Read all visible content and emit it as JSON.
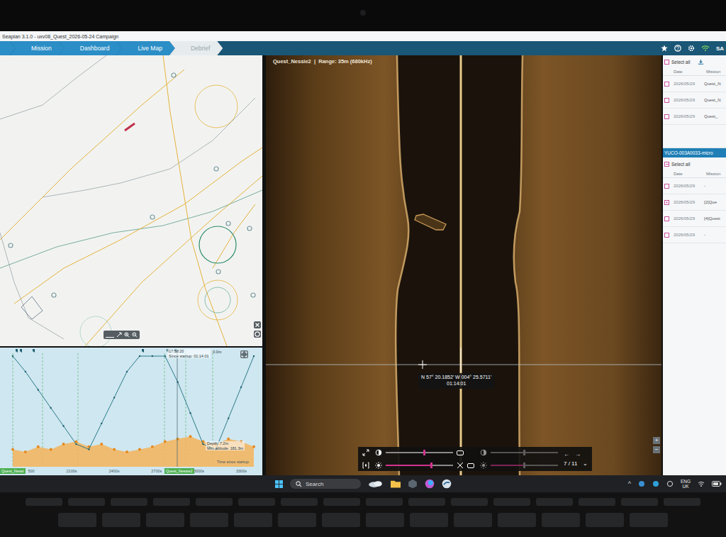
{
  "window": {
    "title": "Seaplan 3.1.0 - uxv08_Quest_2026-05-24 Campaign"
  },
  "nav": [
    {
      "label": "Mission",
      "selected": false
    },
    {
      "label": "Dashboard",
      "selected": false
    },
    {
      "label": "Live Map",
      "selected": false
    },
    {
      "label": "Debrief",
      "selected": true
    }
  ],
  "header_user": "SA",
  "chart": {
    "cursor_time": "17:58:20",
    "since_startup": "Since startup: 01:14:01",
    "cursor_depth": "0.0m",
    "depth_label": "Depth: 7.2m",
    "altitude_label": "Min. altitude: 181.3m",
    "axis_title": "Time since startup",
    "x_ticks": [
      "500",
      "2100s",
      "2400s",
      "2700s",
      "3000s",
      "3300s"
    ],
    "mission_tags": [
      "Quest_Nessi",
      "Quest_Nessie2"
    ],
    "vehicle_depth": [
      0,
      6,
      13,
      20,
      27,
      34,
      36,
      26,
      16,
      6,
      0,
      0,
      0,
      10,
      22,
      34,
      36,
      24,
      12,
      0
    ],
    "seabed": [
      36,
      37,
      35,
      36,
      34,
      33,
      35,
      34,
      36,
      37,
      36,
      35,
      33,
      32,
      31,
      33,
      34,
      32,
      33,
      35
    ]
  },
  "sonar": {
    "title": "Quest_Nessie2  |  Range: 35m (680kHz)",
    "cursor_position": "N 57° 20.1852’ W 004° 25.5711’",
    "cursor_time": "01:14:01",
    "channels": [
      {
        "contrast": 0.57,
        "brightness": 0.68,
        "enabled": true
      },
      {
        "contrast": 0.5,
        "brightness": 0.5,
        "enabled": false
      }
    ],
    "prev": "←",
    "next": "→",
    "page": "7 / 11",
    "page_menu": "⌄",
    "zoom_in": "+",
    "zoom_out": "−"
  },
  "right_panel": {
    "top": {
      "select_all": "Select all",
      "columns": [
        "Date",
        "Mission"
      ],
      "rows": [
        {
          "date": "2026/05/29",
          "mission": "Quest_N",
          "checked": false
        },
        {
          "date": "2026/05/29",
          "mission": "Quest_N",
          "checked": false
        },
        {
          "date": "2026/05/29",
          "mission": "Quest_",
          "checked": false
        }
      ]
    },
    "group": {
      "title": "YUCO-003A0033-micro",
      "select_all": "Select all",
      "partial": true,
      "columns": [
        "Date",
        "Mission"
      ],
      "rows": [
        {
          "date": "2026/05/29",
          "mission": "-",
          "checked": false
        },
        {
          "date": "2026/05/29",
          "mission": "[2]Que",
          "checked": true
        },
        {
          "date": "2026/05/29",
          "mission": "[4]Quest",
          "checked": false
        },
        {
          "date": "2026/05/29",
          "mission": "-",
          "checked": false
        }
      ]
    }
  },
  "taskbar": {
    "search_placeholder": "Search",
    "language": "ENG",
    "region": "UK",
    "tray_chevron": "^"
  }
}
